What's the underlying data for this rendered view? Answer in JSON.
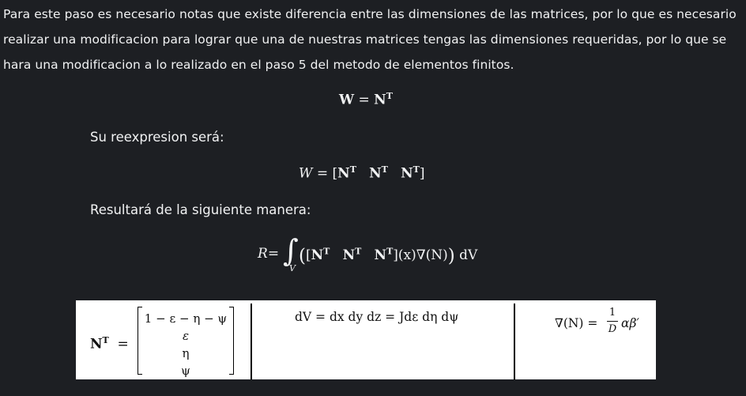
{
  "paragraph": "Para este paso es necesario notas que existe diferencia entre las dimensiones de las matrices, por lo que es necesario realizar una modificacion para lograr que una de nuestras matrices tengas las dimensiones requeridas, por lo que se hara una modificacion a lo realizado en el paso 5 del metodo de elementos finitos.",
  "eq1": {
    "lhs": "W",
    "eq": " = ",
    "rhs": "N",
    "sup": "T"
  },
  "label1": "Su reexpresion será:",
  "eq2": {
    "lhs": "W",
    "eq": " = [",
    "n": "N",
    "sup": "T",
    "close": "]"
  },
  "label2": "Resultará de la siguiente manera:",
  "eq3": {
    "lhs": "R",
    "eq": "=",
    "integral": "∫",
    "sub": "V",
    "open": "(",
    "bracket_open": "[",
    "n": "N",
    "sup": "T",
    "tail": "](x)∇(N)",
    "close": ")",
    "dv": " dV"
  },
  "box": {
    "nt_label": "N",
    "nt_sup": "T",
    "nt_eq": "=",
    "matrix": [
      "1 − ε − η − ψ",
      "ε",
      "η",
      "ψ"
    ],
    "dv_eq": "dV = dx dy dz = Jdε dη dψ",
    "grad_lhs": "∇(N) = ",
    "frac_num": "1",
    "frac_den": "D",
    "grad_rhs": "αβ′"
  }
}
